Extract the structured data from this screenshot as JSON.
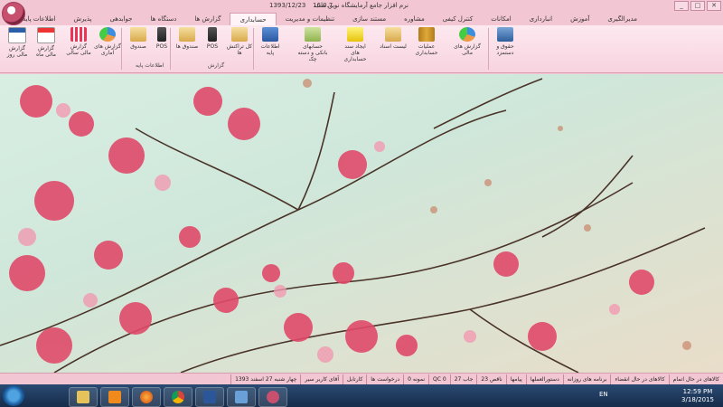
{
  "window": {
    "title": "نرم افزار جامع آرمایشگاه نوین طب",
    "version": "16.0.7",
    "date": "1393/12/23",
    "controls": [
      "_",
      "□",
      "✕"
    ]
  },
  "tabs": [
    {
      "label": "مدیرالگیری"
    },
    {
      "label": "آموزش"
    },
    {
      "label": "انبارداری"
    },
    {
      "label": "امکانات"
    },
    {
      "label": "کنترل کیفی"
    },
    {
      "label": "مشاوره"
    },
    {
      "label": "مستند سازی"
    },
    {
      "label": "تنظیمات و مدیریت"
    },
    {
      "label": "حسابداری",
      "active": true
    },
    {
      "label": "گزارش ها"
    },
    {
      "label": "دستگاه ها"
    },
    {
      "label": "جوابدهی"
    },
    {
      "label": "پذیرش"
    },
    {
      "label": "اطلاعات پایه"
    }
  ],
  "ribbon": {
    "buttons": [
      {
        "label": "حقوق و دستمزد",
        "icon": "users-icon"
      },
      {
        "label": "گزارش های مالی",
        "icon": "chart-icon"
      },
      {
        "label": "عملیات حسابداری",
        "icon": "books-icon"
      },
      {
        "label": "لیست اسناد",
        "icon": "folder-icon"
      },
      {
        "label": "ایجاد سند های حسابداری",
        "icon": "notepad-icon"
      },
      {
        "label": "حسابهای بانکی و دسته چک",
        "icon": "checkbook-icon"
      },
      {
        "label": "اطلاعات پایه",
        "icon": "list-icon"
      },
      {
        "label": "کل تراکنش ها",
        "icon": "folder-icon"
      },
      {
        "label": "POS",
        "icon": "pos-icon"
      },
      {
        "label": "صندوق ها",
        "icon": "folder-icon"
      },
      {
        "label": "POS",
        "icon": "pos-icon"
      },
      {
        "label": "صندوق",
        "icon": "folder-icon"
      },
      {
        "label": "گزارش های آماری",
        "icon": "chart-icon"
      },
      {
        "label": "گزارش مالی سالی",
        "icon": "calendar-grid-icon"
      },
      {
        "label": "گزارش مالی ماه",
        "icon": "calendar-month-icon"
      },
      {
        "label": "گزارش مالی روز",
        "icon": "calendar-day-icon"
      }
    ],
    "groups": [
      "گزارش",
      "اطلاعات پایه"
    ]
  },
  "statusbar": [
    "کالاهای در حال اتمام",
    "کالاهای در حال انقضاء",
    "برنامه های روزانه",
    "دستورالعملها",
    "پیامها",
    "ناقص 23",
    "جاب 27",
    "QC 0",
    "نمونه 0",
    "درخواست ها",
    "کارتابل",
    "آقای کاربر سیر",
    "چهار شنبه 27 اسفند 1393"
  ],
  "taskbar": {
    "apps": [
      "explorer",
      "media-player",
      "firefox",
      "chrome",
      "word",
      "remote-desktop",
      "lab-app"
    ],
    "language": "EN",
    "clock_time": "12:59 PM",
    "clock_date": "3/18/2015"
  }
}
